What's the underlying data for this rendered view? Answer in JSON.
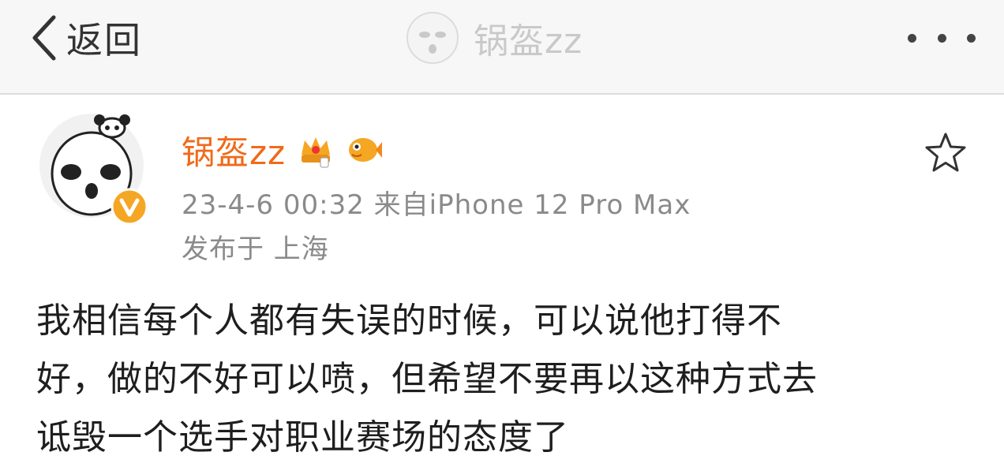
{
  "nav": {
    "back_label": "返回",
    "title": "锅盔zz",
    "more_icon": "more-dots-icon"
  },
  "post": {
    "username": "锅盔zz",
    "timestamp_source": "23-4-6 00:32  来自iPhone 12 Pro Max",
    "location": "发布于 上海",
    "body_lines": [
      "我相信每个人都有失误的时候，可以说他打得不",
      "好，做的不好可以喷，但希望不要再以这种方式去",
      "诋毁一个选手对职业赛场的态度了"
    ],
    "icons": {
      "avatar": "panda-meme-avatar",
      "verified": "verified-v-badge-icon",
      "crown_badge": "crown-badge-icon",
      "fish_badge": "fish-badge-icon",
      "favorite": "star-icon"
    }
  },
  "colors": {
    "username": "#f06a1a",
    "verified": "#f5a623",
    "meta": "#8a8a8a",
    "body": "#1e1e1e",
    "navbar_bg": "#f7f7f7"
  }
}
